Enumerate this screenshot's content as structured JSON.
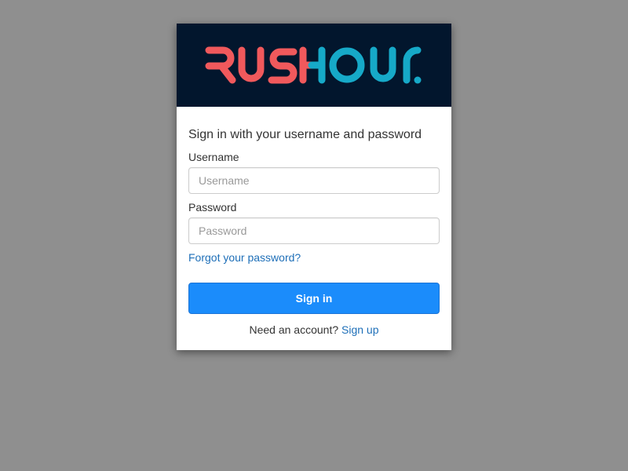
{
  "logo": {
    "text": "RUSHOUR",
    "part1": "RUS",
    "part2": "HOUR",
    "color_part1": "#f0595c",
    "color_part2": "#16a9c8",
    "background": "#02162d"
  },
  "form": {
    "heading": "Sign in with your username and password",
    "username_label": "Username",
    "username_placeholder": "Username",
    "username_value": "",
    "password_label": "Password",
    "password_placeholder": "Password",
    "password_value": "",
    "forgot_link": "Forgot your password?",
    "submit_label": "Sign in",
    "signup_prompt": "Need an account?",
    "signup_link": "Sign up"
  },
  "colors": {
    "page_background": "#8f8f8f",
    "primary_button": "#1b8cfb",
    "link": "#1e6fb8"
  }
}
